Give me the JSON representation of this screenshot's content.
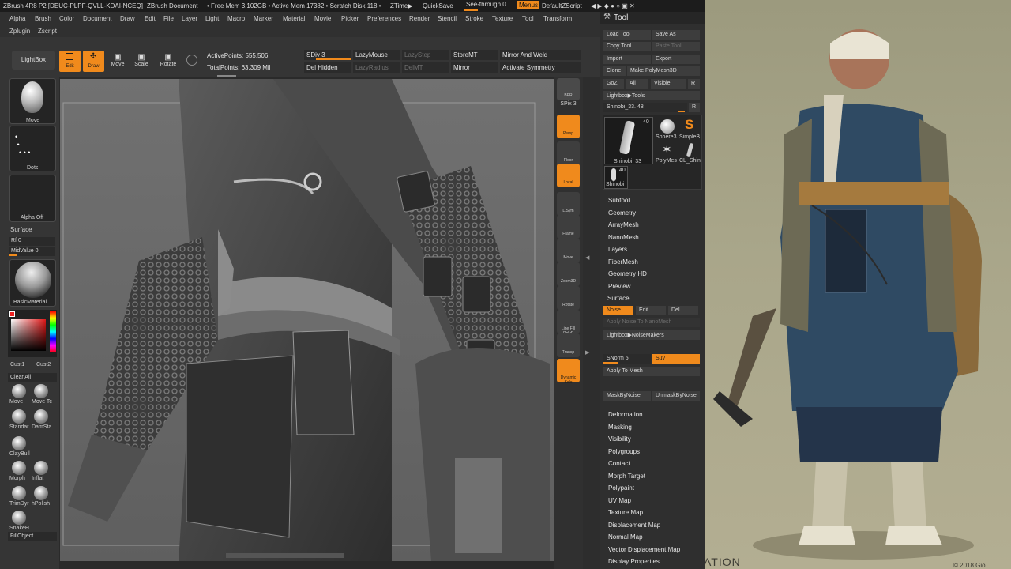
{
  "titlebar": {
    "app": "ZBrush 4R8 P2 [DEUC-PLPF-QVLL-KDAI-NCEQ]",
    "document": "ZBrush Document",
    "freemem": "• Free Mem 3.102GB • Active Mem 17382 • Scratch Disk 118 •",
    "ztime": "ZTime▶",
    "quicksave": "QuickSave",
    "seethrough": "See-through  0",
    "menus": "Menus",
    "script": "DefaultZScript"
  },
  "menus": [
    "Alpha",
    "Brush",
    "Color",
    "Document",
    "Draw",
    "Edit",
    "File",
    "Layer",
    "Light",
    "Macro",
    "Marker",
    "Material",
    "Movie",
    "Picker",
    "Preferences",
    "Render",
    "Stencil",
    "Stroke",
    "Texture",
    "Tool",
    "Transform"
  ],
  "menus2": [
    "Zplugin",
    "Zscript"
  ],
  "toolbar": {
    "lightbox": "LightBox",
    "edit": "Edit",
    "draw": "Draw",
    "move": "Move",
    "scale": "Scale",
    "rotate": "Rotate",
    "active_points": "ActivePoints: 555,506",
    "total_points": "TotalPoints: 63.309 Mil",
    "sdiv": "SDiv 3",
    "lazymouse": "LazyMouse",
    "lazystep": "LazyStep",
    "storemt": "StoreMT",
    "mirror_weld": "Mirror And Weld",
    "del_hidden": "Del Hidden",
    "lazyradius": "LazyRadius",
    "delmt": "DelMT",
    "mirror": "Mirror",
    "activate_symmetry": "Activate Symmetry"
  },
  "left": {
    "brush": "Move",
    "stroke": "Dots",
    "alpha": "Alpha Off",
    "surface": "Surface",
    "rf": "Rf 0",
    "midvalue": "MidValue 0",
    "material": "BasicMaterial",
    "cust1": "Cust1",
    "cust2": "Cust2",
    "clear_all": "Clear All",
    "brushes": [
      "Move",
      "Move Tc",
      "Standar",
      "DamSta",
      "ClayBuil",
      "Morph",
      "Inflat",
      "TrimDyr",
      "hPolish",
      "SnakeH"
    ],
    "fillobject": "FillObject"
  },
  "rightshelf": [
    "SPix 3",
    "Persp",
    "Floor",
    "Local",
    "L.Sym",
    "Frame",
    "Move",
    "Zoom3D",
    "Rotate",
    "Line Fill PolyF",
    "Transp",
    "Dynamic Solo"
  ],
  "tool": {
    "title": "Tool",
    "load": "Load Tool",
    "save_as": "Save As",
    "copy": "Copy Tool",
    "paste": "Paste Tool",
    "import": "Import",
    "export": "Export",
    "clone": "Clone",
    "make_polymesh": "Make PolyMesh3D",
    "goz": "GoZ",
    "all": "All",
    "visible": "Visible",
    "r": "R",
    "lightbox_tools": "Lightbox▶Tools",
    "current": "Shinobi_33. 48",
    "thumb_count": "40",
    "thumbs": [
      "Shinobi_33",
      "Sphere3",
      "SimpleB",
      "PolyMes",
      "CL_Shin",
      "Shinobi_"
    ],
    "subpalettes": [
      "Subtool",
      "Geometry",
      "ArrayMesh",
      "NanoMesh",
      "Layers",
      "FiberMesh",
      "Geometry HD",
      "Preview",
      "Surface"
    ],
    "noise": "Noise",
    "edit": "Edit",
    "del": "Del",
    "apply_noise": "Apply Noise To NanoMesh",
    "noisemakers": "Lightbox▶NoiseMakers",
    "snorm": "SNorm 5",
    "suv": "Suv",
    "apply_mesh": "Apply To Mesh",
    "maskbynoise": "MaskByNoise",
    "unmaskbynoise": "UnmaskByNoise",
    "subpalettes2": [
      "Deformation",
      "Masking",
      "Visibility",
      "Polygroups",
      "Contact",
      "Morph Target",
      "Polypaint",
      "UV Map",
      "Texture Map",
      "Displacement Map",
      "Normal Map",
      "Vector Displacement Map",
      "Display Properties"
    ]
  },
  "reference": {
    "caption": "ATION",
    "copyright": "© 2018 Gio"
  },
  "colors": {
    "accent": "#f08a1c",
    "panel": "#2f2f2f"
  }
}
